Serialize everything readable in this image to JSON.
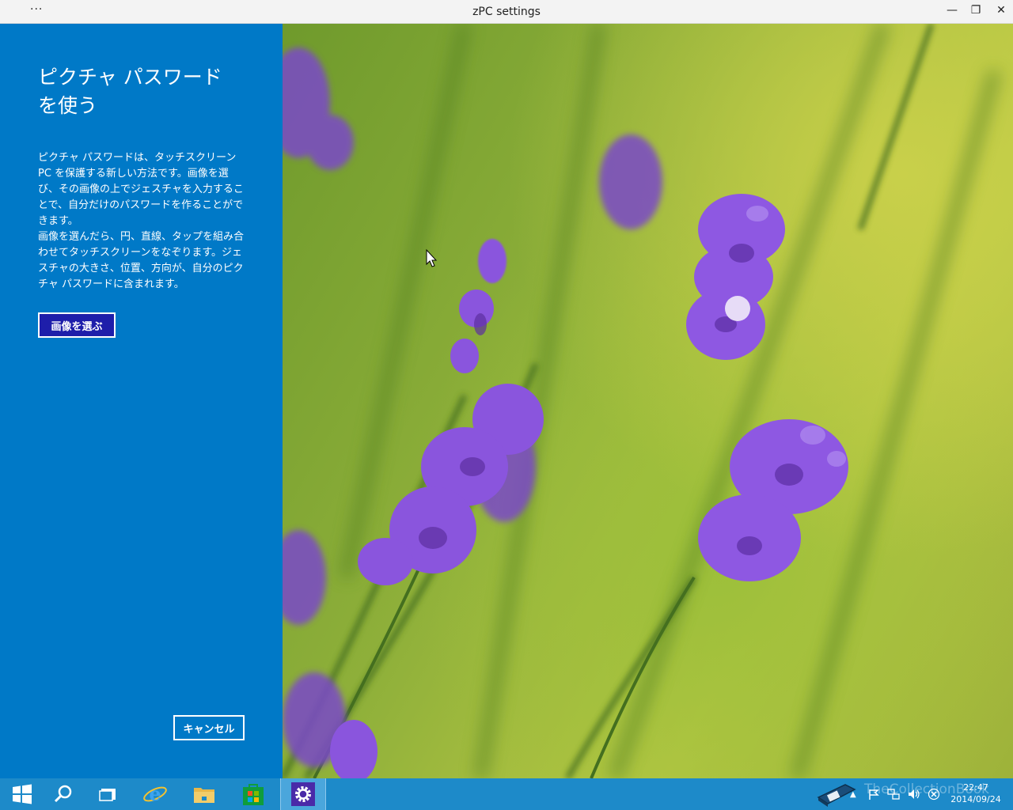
{
  "window": {
    "title": "zPC settings",
    "menu_glyph": "···",
    "min_glyph": "—",
    "max_glyph": "❐",
    "close_glyph": "✕"
  },
  "panel": {
    "heading": "ピクチャ パスワードを使う",
    "para1": "ピクチャ パスワードは、タッチスクリーン PC を保護する新しい方法です。画像を選び、その画像の上でジェスチャを入力することで、自分だけのパスワードを作ることができます。",
    "para2": "画像を選んだら、円、直線、タップを組み合わせてタッチスクリーンをなぞります。ジェスチャの大きさ、位置、方向が、自分のピクチャ パスワードに含まれます。",
    "choose_button": "画像を選ぶ",
    "cancel_button": "キャンセル",
    "bg_color": "#0079c7",
    "choose_button_color": "#1e1eaa"
  },
  "taskbar": {
    "items": [
      "start-icon",
      "search-icon",
      "task-view-icon",
      "internet-explorer-icon",
      "file-explorer-icon",
      "store-icon",
      "settings-icon"
    ],
    "watermark": "TheCollectionBook",
    "time": "22:47",
    "date": "2014/09/24",
    "bg_color": "#1d8ac9"
  }
}
